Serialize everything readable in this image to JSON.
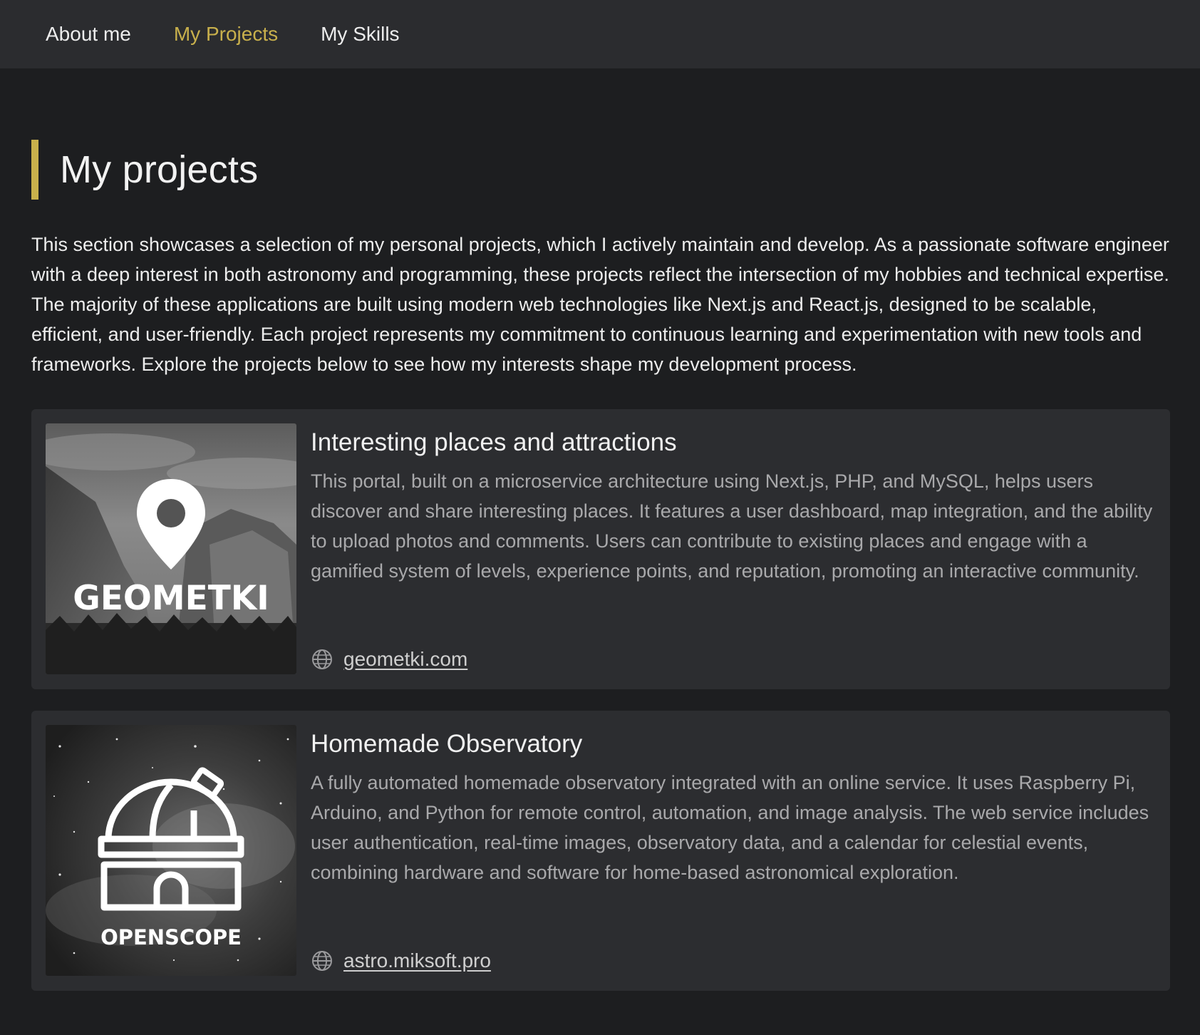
{
  "nav": {
    "items": [
      {
        "label": "About me"
      },
      {
        "label": "My Projects"
      },
      {
        "label": "My Skills"
      }
    ]
  },
  "colors": {
    "accent": "#c8b04c",
    "background": "#1d1e20",
    "nav_background": "#2b2c2f",
    "card_background": "#2c2d30"
  },
  "page": {
    "title": "My projects",
    "intro": "This section showcases a selection of my personal projects, which I actively maintain and develop. As a passionate software engineer with a deep interest in both astronomy and programming, these projects reflect the intersection of my hobbies and technical expertise. The majority of these applications are built using modern web technologies like Next.js and React.js, designed to be scalable, efficient, and user-friendly. Each project represents my commitment to continuous learning and experimentation with new tools and frameworks. Explore the projects below to see how my interests shape my development process."
  },
  "projects": [
    {
      "title": "Interesting places and attractions",
      "description": "This portal, built on a microservice architecture using Next.js, PHP, and MySQL, helps users discover and share interesting places. It features a user dashboard, map integration, and the ability to upload photos and comments. Users can contribute to existing places and engage with a gamified system of levels, experience points, and reputation, promoting an interactive community.",
      "link": "geometki.com",
      "logo_text": "GEOMETKI",
      "icon": "globe-icon"
    },
    {
      "title": "Homemade Observatory",
      "description": "A fully automated homemade observatory integrated with an online service. It uses Raspberry Pi, Arduino, and Python for remote control, automation, and image analysis. The web service includes user authentication, real-time images, observatory data, and a calendar for celestial events, combining hardware and software for home-based astronomical exploration.",
      "link": "astro.miksoft.pro",
      "logo_text": "OPENSCOPE",
      "icon": "globe-icon"
    }
  ]
}
